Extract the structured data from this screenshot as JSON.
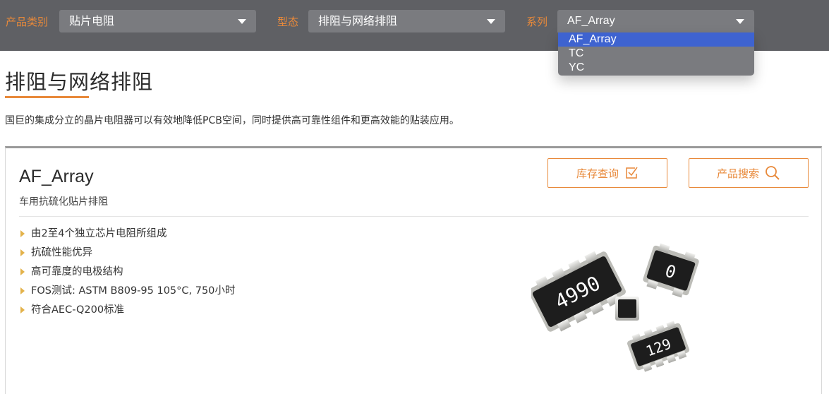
{
  "filters": [
    {
      "label": "产品类别",
      "value": "贴片电阻"
    },
    {
      "label": "型态",
      "value": "排阻与网络排阻"
    },
    {
      "label": "系列",
      "value": "AF_Array"
    }
  ],
  "dropdown": {
    "options": [
      "AF_Array",
      "TC",
      "YC"
    ],
    "selected": "AF_Array"
  },
  "page": {
    "title": "排阻与网络排阻",
    "description": "国巨的集成分立的晶片电阻器可以有效地降低PCB空间，同时提供高可靠性组件和更高效能的贴装应用。"
  },
  "product": {
    "name": "AF_Array",
    "subtitle": "车用抗硫化贴片排阻",
    "buttons": {
      "inventory": "库存查询",
      "search": "产品搜索"
    },
    "features": [
      "由2至4个独立芯片电阻所组成",
      "抗硫性能优异",
      "高可靠度的电极结构",
      "FOS测试: ASTM B809-95 105°C, 750小时",
      "符合AEC-Q200标准"
    ],
    "image": {
      "chip_markings": [
        "4990",
        "0",
        "129"
      ]
    }
  },
  "colors": {
    "accent": "#e8893a",
    "bar_background": "#5f6064",
    "select_background": "#7a7b7f",
    "dropdown_highlight": "#3e63d0",
    "bullet": "#e3b24a"
  }
}
